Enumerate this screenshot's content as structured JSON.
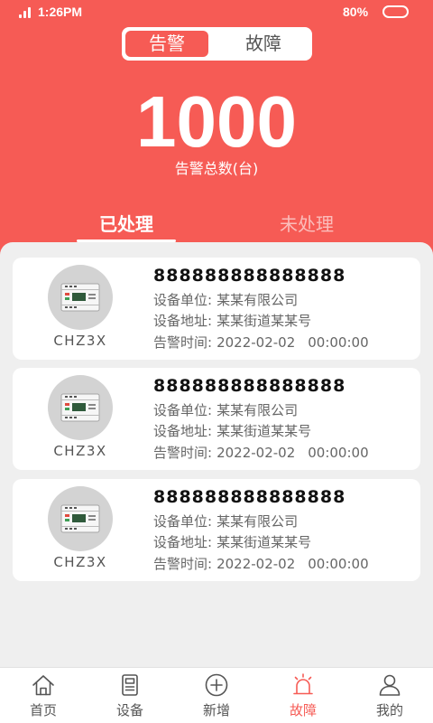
{
  "colors": {
    "primary": "#F65B55",
    "background": "#EFEFEF",
    "nav_inactive": "#555555"
  },
  "status_bar": {
    "time": "1:26PM",
    "battery": "80%",
    "icons": [
      "signal-icon",
      "battery-icon"
    ]
  },
  "segment": [
    {
      "label": "告警",
      "active": true
    },
    {
      "label": "故障",
      "active": false
    }
  ],
  "summary": {
    "count": "1000",
    "label": "告警总数(台)"
  },
  "tabs": [
    {
      "label": "已处理",
      "active": true
    },
    {
      "label": "未处理",
      "active": false
    }
  ],
  "alarms": [
    {
      "image_icon": "device-photo",
      "model": "CHZ3X",
      "id": "888888888888888",
      "unit_label": "设备单位:",
      "unit": "某某有限公司",
      "address_label": "设备地址:",
      "address": "某某街道某某号",
      "time_label": "告警时间:",
      "date": "2022-02-02",
      "time": "00:00:00"
    },
    {
      "image_icon": "device-photo",
      "model": "CHZ3X",
      "id": "888888888888888",
      "unit_label": "设备单位:",
      "unit": "某某有限公司",
      "address_label": "设备地址:",
      "address": "某某街道某某号",
      "time_label": "告警时间:",
      "date": "2022-02-02",
      "time": "00:00:00"
    },
    {
      "image_icon": "device-photo",
      "model": "CHZ3X",
      "id": "888888888888888",
      "unit_label": "设备单位:",
      "unit": "某某有限公司",
      "address_label": "设备地址:",
      "address": "某某街道某某号",
      "time_label": "告警时间:",
      "date": "2022-02-02",
      "time": "00:00:00"
    }
  ],
  "bottom_nav": [
    {
      "label": "首页",
      "icon": "home-icon",
      "active": false
    },
    {
      "label": "设备",
      "icon": "device-icon",
      "active": false
    },
    {
      "label": "新增",
      "icon": "add-circle-icon",
      "active": false
    },
    {
      "label": "故障",
      "icon": "alarm-icon",
      "active": true
    },
    {
      "label": "我的",
      "icon": "user-icon",
      "active": false
    }
  ]
}
